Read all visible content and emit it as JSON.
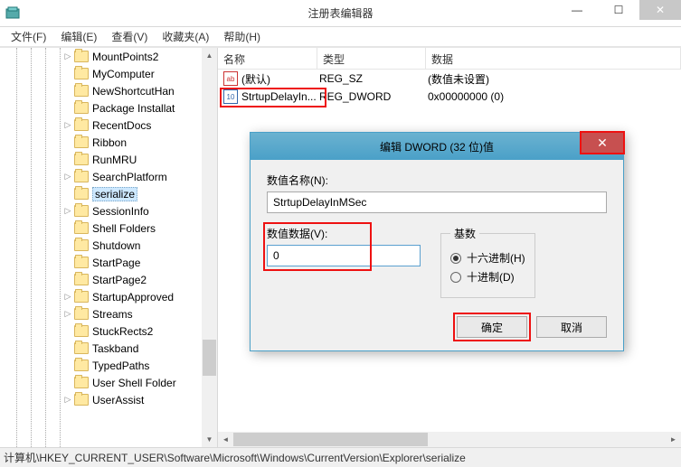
{
  "window": {
    "title": "注册表编辑器"
  },
  "menu": {
    "file": "文件(F)",
    "edit": "编辑(E)",
    "view": "查看(V)",
    "fav": "收藏夹(A)",
    "help": "帮助(H)"
  },
  "tree": {
    "items": [
      {
        "label": "MountPoints2",
        "expandable": true
      },
      {
        "label": "MyComputer"
      },
      {
        "label": "NewShortcutHan"
      },
      {
        "label": "Package Installat"
      },
      {
        "label": "RecentDocs",
        "expandable": true
      },
      {
        "label": "Ribbon"
      },
      {
        "label": "RunMRU"
      },
      {
        "label": "SearchPlatform",
        "expandable": true
      },
      {
        "label": "serialize",
        "selected": true
      },
      {
        "label": "SessionInfo",
        "expandable": true
      },
      {
        "label": "Shell Folders"
      },
      {
        "label": "Shutdown"
      },
      {
        "label": "StartPage"
      },
      {
        "label": "StartPage2"
      },
      {
        "label": "StartupApproved",
        "expandable": true
      },
      {
        "label": "Streams",
        "expandable": true
      },
      {
        "label": "StuckRects2"
      },
      {
        "label": "Taskband"
      },
      {
        "label": "TypedPaths"
      },
      {
        "label": "User Shell Folder"
      },
      {
        "label": "UserAssist",
        "expandable": true
      }
    ]
  },
  "list": {
    "headers": {
      "name": "名称",
      "type": "类型",
      "data": "数据"
    },
    "rows": [
      {
        "icon": "ab",
        "name": "(默认)",
        "type": "REG_SZ",
        "data": "(数值未设置)"
      },
      {
        "icon": "dw",
        "name": "StrtupDelayIn...",
        "type": "REG_DWORD",
        "data": "0x00000000 (0)"
      }
    ]
  },
  "dialog": {
    "title": "编辑 DWORD (32 位)值",
    "name_label": "数值名称(N):",
    "name_value": "StrtupDelayInMSec",
    "data_label": "数值数据(V):",
    "data_value": "0",
    "base_label": "基数",
    "hex": "十六进制(H)",
    "dec": "十进制(D)",
    "ok": "确定",
    "cancel": "取消"
  },
  "status": {
    "path": "计算机\\HKEY_CURRENT_USER\\Software\\Microsoft\\Windows\\CurrentVersion\\Explorer\\serialize"
  }
}
